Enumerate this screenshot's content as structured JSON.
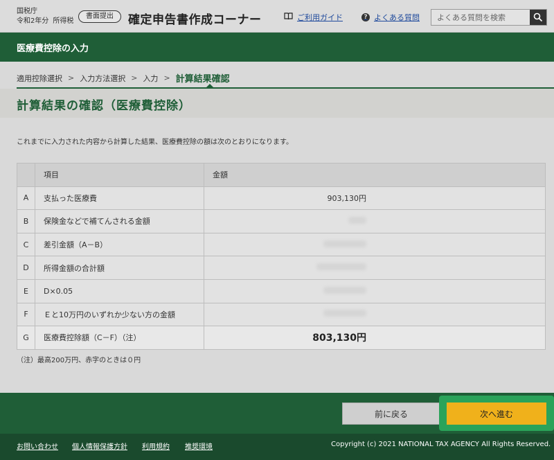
{
  "header": {
    "agency": "国税庁",
    "year": "令和2年分",
    "tax_type": "所得税",
    "badge": "書面提出",
    "title": "確定申告書作成コーナー",
    "guide_link": "ご利用ガイド",
    "faq_link": "よくある質問",
    "search_placeholder": "よくある質問を検索",
    "guide_icon": "book-icon",
    "faq_icon": "question-circle-icon",
    "search_icon": "magnifier-icon"
  },
  "section": {
    "title": "医療費控除の入力"
  },
  "steps": {
    "items": [
      "適用控除選択",
      "入力方法選択",
      "入力"
    ],
    "current": "計算結果確認"
  },
  "page": {
    "title": "計算結果の確認（医療費控除）",
    "intro": "これまでに入力された内容から計算した結果、医療費控除の額は次のとおりになります。",
    "note": "（注）最高200万円、赤字のときは０円"
  },
  "table": {
    "headers": [
      "",
      "項目",
      "金額"
    ],
    "rows": [
      {
        "key": "A",
        "item": "支払った医療費",
        "amount": "903,130円"
      },
      {
        "key": "B",
        "item": "保険金などで補てんされる金額",
        "amount": ""
      },
      {
        "key": "C",
        "item": "差引金額（A－B）",
        "amount": ""
      },
      {
        "key": "D",
        "item": "所得金額の合計額",
        "amount": ""
      },
      {
        "key": "E",
        "item": "D×0.05",
        "amount": ""
      },
      {
        "key": "F",
        "item": "Ｅと10万円のいずれか少ない方の金額",
        "amount": ""
      },
      {
        "key": "G",
        "item": "医療費控除額（C－F）（注）",
        "amount": "803,130円"
      }
    ]
  },
  "buttons": {
    "back": "前に戻る",
    "next": "次へ進む"
  },
  "footer": {
    "links": [
      "お問い合わせ",
      "個人情報保護方針",
      "利用規約",
      "推奨環境"
    ],
    "copyright": "Copyright (c) 2021 NATIONAL TAX AGENCY All Rights Reserved."
  },
  "colors": {
    "brand_green": "#1f5e37",
    "next_button": "#f0b11b",
    "highlight": "#2aa35a"
  }
}
